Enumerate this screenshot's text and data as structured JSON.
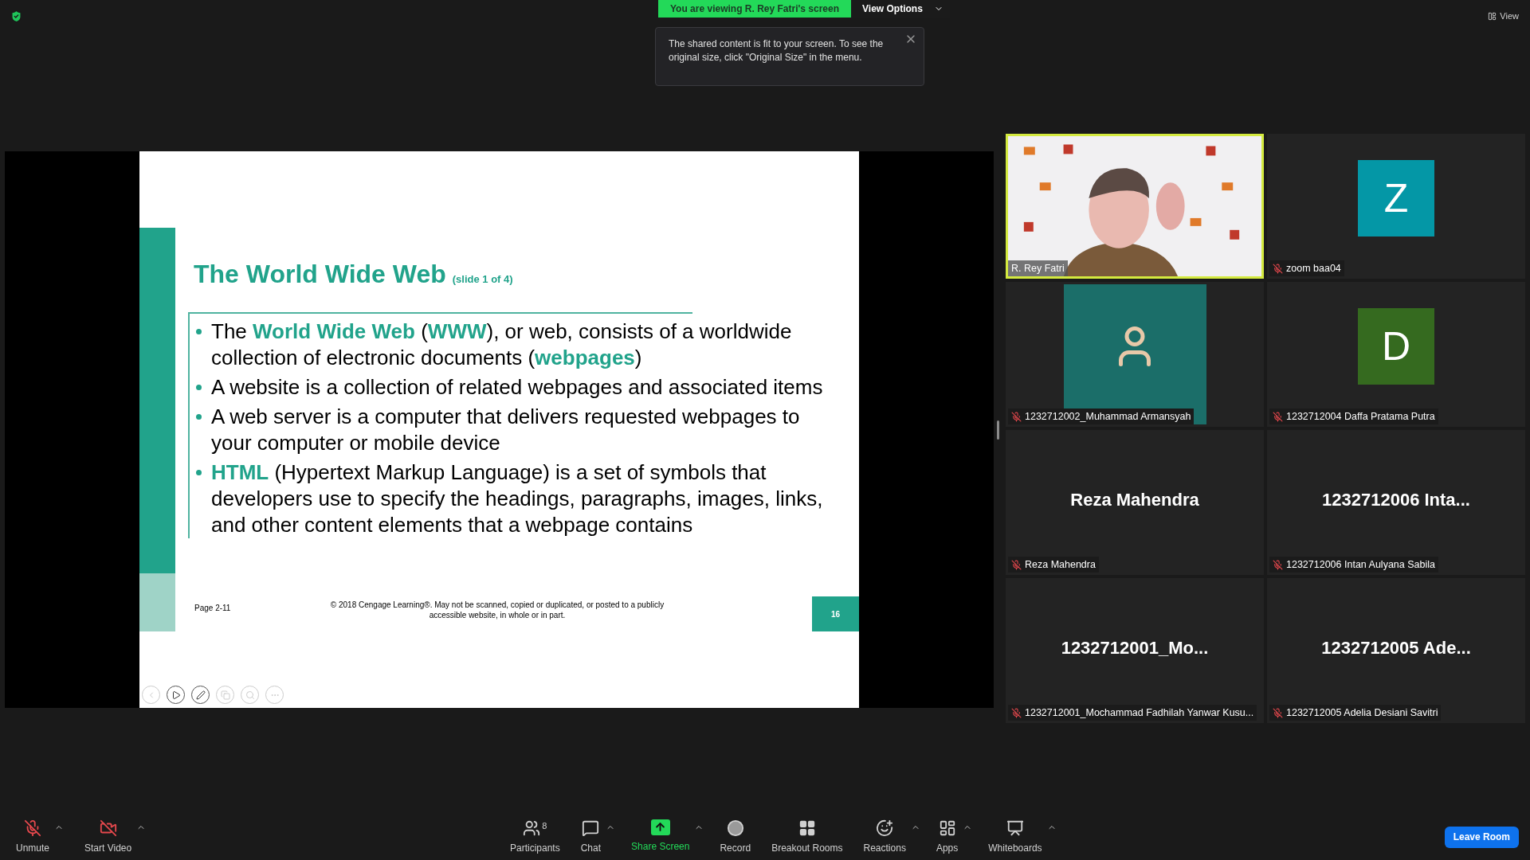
{
  "share_banner": {
    "text": "You are viewing R. Rey Fatri's screen",
    "view_options": "View Options"
  },
  "notice": {
    "text": "The shared content is fit to your screen. To see the original size, click \"Original Size\" in the menu."
  },
  "view_button": "View",
  "slide": {
    "title": "The World Wide Web",
    "subtitle": "(slide 1 of 4)",
    "bullets": [
      "The **World Wide Web** (**WWW**), or web, consists of a worldwide collection of electronic documents (**webpages**)",
      "A website is a collection of related webpages and associated items",
      "A web server is a computer that delivers requested webpages to your computer or mobile device",
      "**HTML** (Hypertext Markup Language) is a set of symbols that developers use to specify the headings, paragraphs, images, links, and other content elements that a webpage contains"
    ],
    "page": "Page 2-11",
    "copyright": "© 2018 Cengage Learning®. May not be scanned, copied or duplicated, or posted to a publicly accessible website, in whole or in part.",
    "number": "16"
  },
  "participants": [
    {
      "kind": "video",
      "name": "R. Rey Fatri",
      "muted": false,
      "speaking": true
    },
    {
      "kind": "initial",
      "initial": "Z",
      "color": "#0497a6",
      "name": "zoom baa04",
      "muted": true,
      "speaking": false
    },
    {
      "kind": "avatar",
      "name": "1232712002_Muhammad Armansyah",
      "muted": true,
      "speaking": false
    },
    {
      "kind": "initial",
      "initial": "D",
      "color": "#356a1f",
      "name": "1232712004 Daffa Pratama Putra",
      "muted": true,
      "speaking": false
    },
    {
      "kind": "name",
      "display": "Reza Mahendra",
      "name": "Reza Mahendra",
      "muted": true,
      "speaking": false
    },
    {
      "kind": "name",
      "display": "1232712006 Inta...",
      "name": "1232712006 Intan Aulyana Sabila",
      "muted": true,
      "speaking": false
    },
    {
      "kind": "name",
      "display": "1232712001_Mo...",
      "name": "1232712001_Mochammad Fadhilah Yanwar Kusu...",
      "muted": true,
      "speaking": false
    },
    {
      "kind": "name",
      "display": "1232712005 Ade...",
      "name": "1232712005 Adelia Desiani Savitri",
      "muted": true,
      "speaking": false
    }
  ],
  "toolbar": {
    "left": [
      {
        "kind": "audio",
        "label": "Unmute",
        "muted": true,
        "caret": true
      },
      {
        "kind": "video",
        "label": "Start Video",
        "on": false,
        "caret": true
      }
    ],
    "center": [
      {
        "kind": "participants",
        "label": "Participants",
        "count": "8",
        "caret": false
      },
      {
        "kind": "chat",
        "label": "Chat",
        "caret": true
      },
      {
        "kind": "share",
        "label": "Share Screen",
        "caret": true
      },
      {
        "kind": "record",
        "label": "Record",
        "caret": false
      },
      {
        "kind": "breakout",
        "label": "Breakout Rooms",
        "caret": false
      },
      {
        "kind": "reactions",
        "label": "Reactions",
        "caret": true
      },
      {
        "kind": "apps",
        "label": "Apps",
        "caret": true
      },
      {
        "kind": "whiteboards",
        "label": "Whiteboards",
        "caret": true
      }
    ],
    "leave": "Leave Room"
  }
}
